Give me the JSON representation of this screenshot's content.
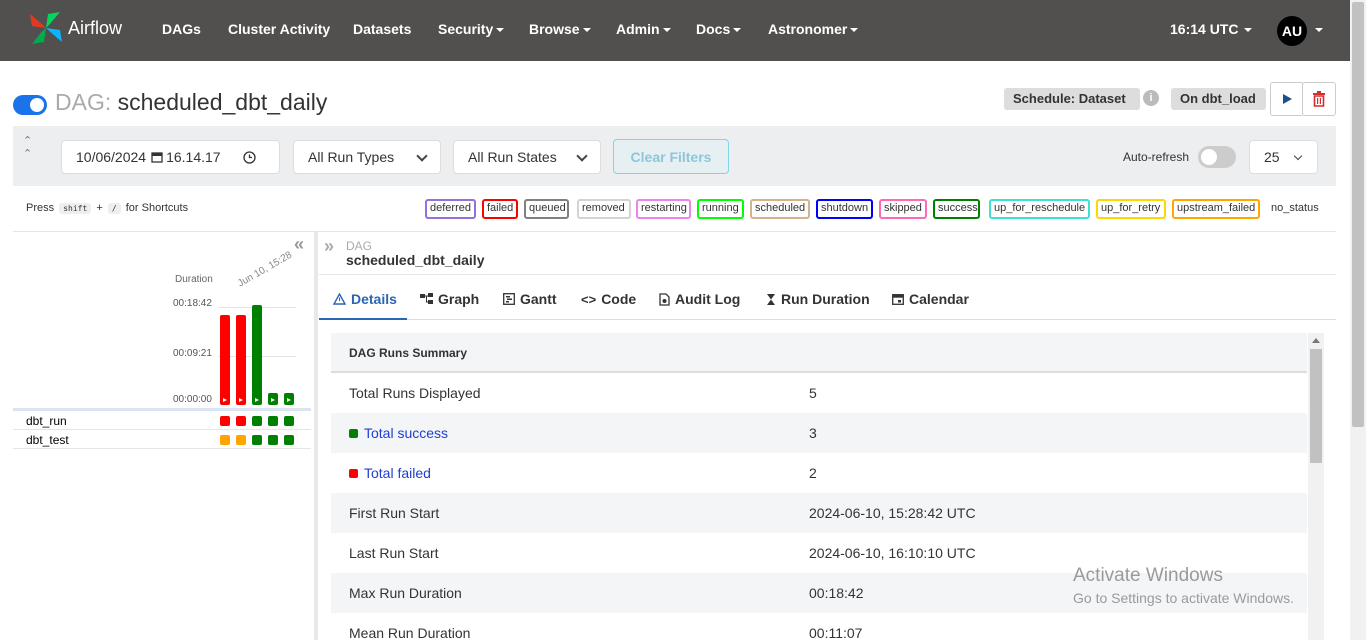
{
  "brand": {
    "name": "Airflow"
  },
  "nav": {
    "items": [
      {
        "label": "DAGs",
        "dropdown": false
      },
      {
        "label": "Cluster Activity",
        "dropdown": false
      },
      {
        "label": "Datasets",
        "dropdown": false
      },
      {
        "label": "Security",
        "dropdown": true
      },
      {
        "label": "Browse",
        "dropdown": true
      },
      {
        "label": "Admin",
        "dropdown": true
      },
      {
        "label": "Docs",
        "dropdown": true
      },
      {
        "label": "Astronomer",
        "dropdown": true
      }
    ],
    "time": "16:14 UTC",
    "user_initials": "AU"
  },
  "dag": {
    "prefix": "DAG:",
    "name": "scheduled_dbt_daily",
    "schedule": "Schedule: Dataset",
    "trigger_label": "On dbt_load",
    "paused": false
  },
  "filters": {
    "date": "10/06/2024",
    "time": "16.14.17",
    "run_types": "All Run Types",
    "run_states": "All Run States",
    "clear_label": "Clear Filters",
    "autorefresh_label": "Auto-refresh",
    "num_runs": "25"
  },
  "shortcuts": {
    "press": "Press",
    "key1": "shift",
    "plus": "+",
    "key2": "/",
    "suffix": "for Shortcuts"
  },
  "legend": [
    {
      "label": "deferred",
      "color": "#9370db"
    },
    {
      "label": "failed",
      "color": "#ff0000"
    },
    {
      "label": "queued",
      "color": "#808080"
    },
    {
      "label": "removed",
      "color": "#d3d3d3"
    },
    {
      "label": "restarting",
      "color": "#ee82ee"
    },
    {
      "label": "running",
      "color": "#00ff00"
    },
    {
      "label": "scheduled",
      "color": "#d2b48c"
    },
    {
      "label": "shutdown",
      "color": "#0000ff"
    },
    {
      "label": "skipped",
      "color": "#ff69b4"
    },
    {
      "label": "success",
      "color": "#008000"
    },
    {
      "label": "up_for_reschedule",
      "color": "#40e0d0"
    },
    {
      "label": "up_for_retry",
      "color": "#ffd700"
    },
    {
      "label": "upstream_failed",
      "color": "#ffa500"
    },
    {
      "label": "no_status",
      "color": "none"
    }
  ],
  "grid": {
    "duration_label": "Duration",
    "date_label": "Jun 10, 15:28",
    "ticks": [
      "00:18:42",
      "00:09:21",
      "00:00:00"
    ],
    "tasks": [
      "dbt_run",
      "dbt_test"
    ]
  },
  "chart_data": {
    "type": "bar",
    "ylabel": "Duration",
    "ylim": [
      0,
      1122
    ],
    "series": [
      {
        "values": [
          1010,
          1010,
          1122,
          120,
          120
        ],
        "states": [
          "failed",
          "failed",
          "success",
          "success",
          "success"
        ]
      }
    ],
    "task_states": {
      "dbt_run": [
        "failed",
        "failed",
        "success",
        "success",
        "success"
      ],
      "dbt_test": [
        "upstream_failed",
        "upstream_failed",
        "success",
        "success",
        "success"
      ]
    },
    "state_colors": {
      "failed": "#ff0000",
      "success": "#008000",
      "upstream_failed": "#ffa500"
    }
  },
  "details": {
    "label": "DAG",
    "name": "scheduled_dbt_daily",
    "tabs": [
      "Details",
      "Graph",
      "Gantt",
      "Code",
      "Audit Log",
      "Run Duration",
      "Calendar"
    ],
    "summary_title": "DAG Runs Summary",
    "rows": [
      {
        "label": "Total Runs Displayed",
        "value": "5"
      },
      {
        "label": "Total success",
        "value": "3",
        "color": "#008000"
      },
      {
        "label": "Total failed",
        "value": "2",
        "color": "#ff0000"
      },
      {
        "label": "First Run Start",
        "value": "2024-06-10, 15:28:42 UTC"
      },
      {
        "label": "Last Run Start",
        "value": "2024-06-10, 16:10:10 UTC"
      },
      {
        "label": "Max Run Duration",
        "value": "00:18:42"
      },
      {
        "label": "Mean Run Duration",
        "value": "00:11:07"
      }
    ]
  },
  "watermark": {
    "line1": "Activate Windows",
    "line2": "Go to Settings to activate Windows."
  }
}
